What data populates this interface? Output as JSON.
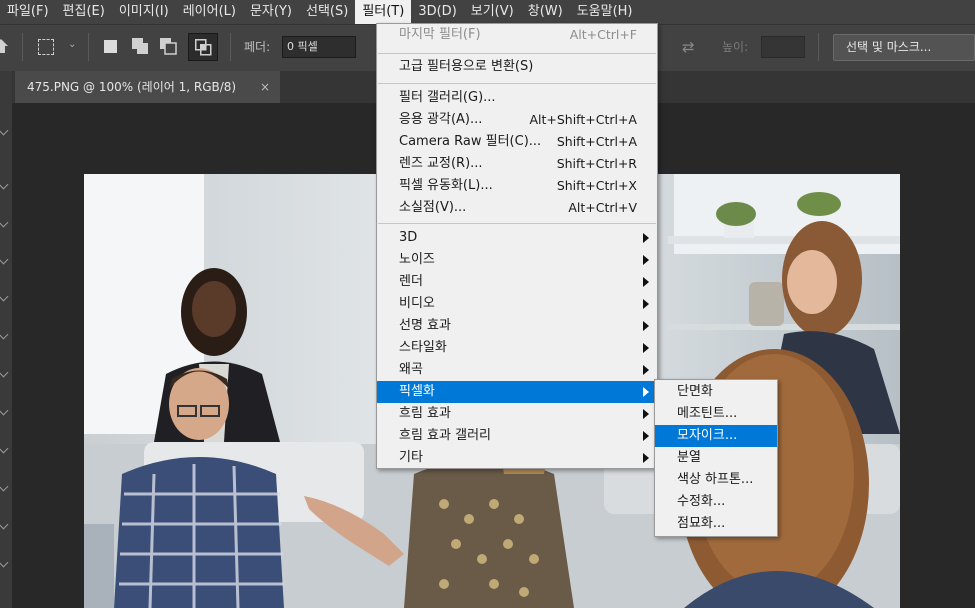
{
  "menubar": {
    "items": [
      {
        "label": "파일(F)"
      },
      {
        "label": "편집(E)"
      },
      {
        "label": "이미지(I)"
      },
      {
        "label": "레이어(L)"
      },
      {
        "label": "문자(Y)"
      },
      {
        "label": "선택(S)"
      },
      {
        "label": "필터(T)"
      },
      {
        "label": "3D(D)"
      },
      {
        "label": "보기(V)"
      },
      {
        "label": "창(W)"
      },
      {
        "label": "도움말(H)"
      }
    ],
    "active_index": 6
  },
  "options": {
    "feather_label": "페더:",
    "feather_value": "0 픽셀",
    "height_label": "높이:",
    "select_mask_label": "선택 및 마스크..."
  },
  "document_tab": {
    "title": "475.PNG @ 100% (레이어 1, RGB/8)",
    "close": "×"
  },
  "filter_menu": {
    "last_filter": {
      "label": "마지막 필터(F)",
      "shortcut": "Alt+Ctrl+F"
    },
    "convert_smart": {
      "label": "고급 필터용으로 변환(S)"
    },
    "group1": [
      {
        "label": "필터 갤러리(G)...",
        "shortcut": ""
      },
      {
        "label": "응용 광각(A)...",
        "shortcut": "Alt+Shift+Ctrl+A"
      },
      {
        "label": "Camera Raw 필터(C)...",
        "shortcut": "Shift+Ctrl+A"
      },
      {
        "label": "렌즈 교정(R)...",
        "shortcut": "Shift+Ctrl+R"
      },
      {
        "label": "픽셀 유동화(L)...",
        "shortcut": "Shift+Ctrl+X"
      },
      {
        "label": "소실점(V)...",
        "shortcut": "Alt+Ctrl+V"
      }
    ],
    "group2": [
      {
        "label": "3D"
      },
      {
        "label": "노이즈"
      },
      {
        "label": "렌더"
      },
      {
        "label": "비디오"
      },
      {
        "label": "선명 효과"
      },
      {
        "label": "스타일화"
      },
      {
        "label": "왜곡"
      },
      {
        "label": "픽셀화"
      },
      {
        "label": "흐림 효과"
      },
      {
        "label": "흐림 효과 갤러리"
      },
      {
        "label": "기타"
      }
    ],
    "highlighted": "픽셀화"
  },
  "pixelate_submenu": {
    "items": [
      {
        "label": "단면화"
      },
      {
        "label": "메조틴트..."
      },
      {
        "label": "모자이크..."
      },
      {
        "label": "분열"
      },
      {
        "label": "색상 하프톤..."
      },
      {
        "label": "수정화..."
      },
      {
        "label": "점묘화..."
      }
    ],
    "highlighted": "모자이크..."
  },
  "colors": {
    "menu_highlight": "#0078d7",
    "menubar_bg": "#424242",
    "workspace_bg": "#282828"
  }
}
